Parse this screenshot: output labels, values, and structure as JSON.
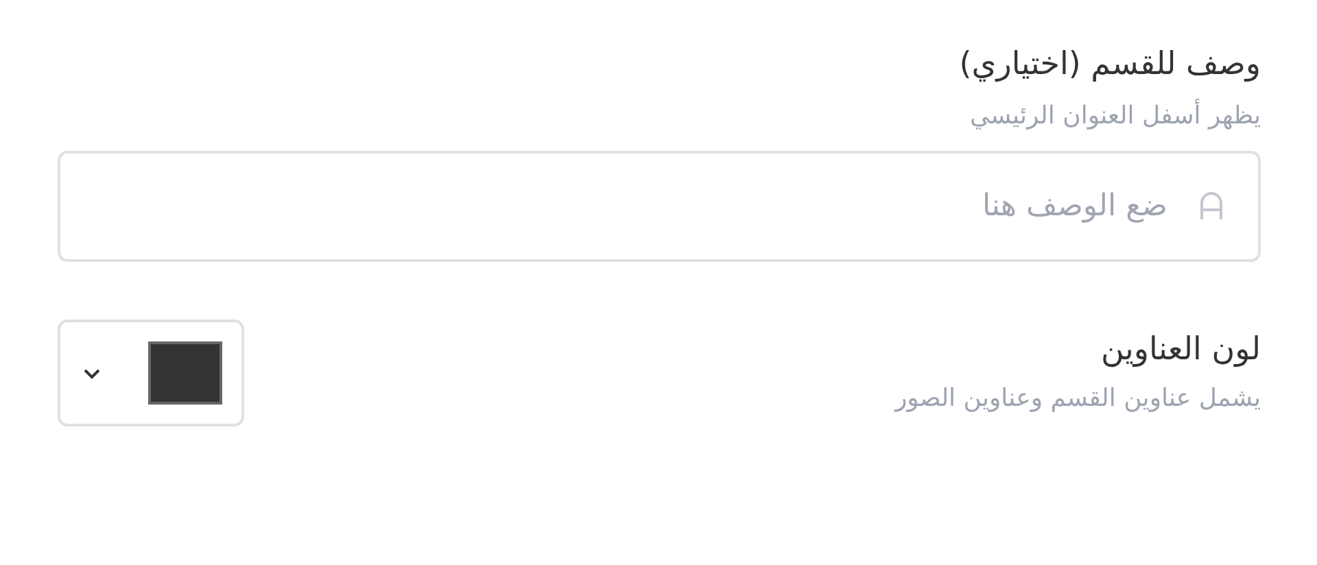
{
  "description_field": {
    "label": "وصف للقسم (اختياري)",
    "hint": "يظهر أسفل العنوان الرئيسي",
    "placeholder": "ضع الوصف هنا"
  },
  "heading_color": {
    "label": "لون العناوين",
    "hint": "يشمل عناوين القسم وعناوين الصور",
    "color": "#333333"
  }
}
